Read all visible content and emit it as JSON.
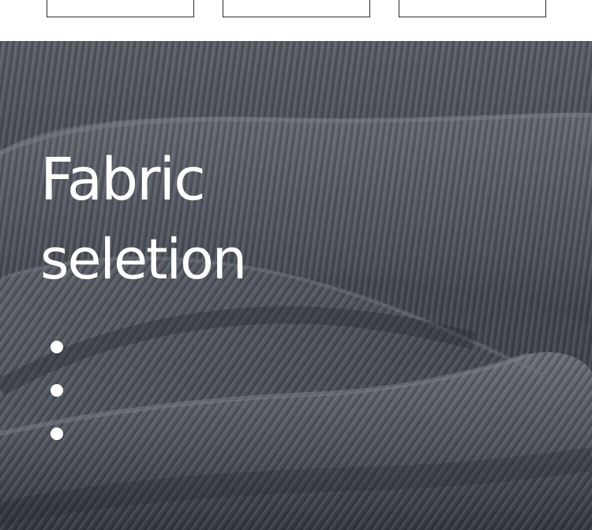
{
  "heading": {
    "line1": "Fabric",
    "line2": "seletion"
  },
  "colors": {
    "fabric_base": "#4b5058",
    "fabric_light": "#6b7079",
    "fabric_dark": "#2d3138",
    "text": "#ffffff"
  },
  "decor": {
    "dots_count": 3
  }
}
